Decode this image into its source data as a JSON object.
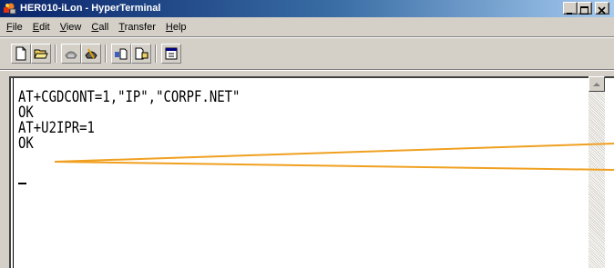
{
  "window": {
    "title": "HER010-iLon - HyperTerminal",
    "app_icon": "hyperterminal-icon",
    "controls": [
      "minimize-icon",
      "maximize-icon",
      "close-icon"
    ]
  },
  "menu": {
    "items": [
      {
        "label": "File",
        "accel": "F"
      },
      {
        "label": "Edit",
        "accel": "E"
      },
      {
        "label": "View",
        "accel": "V"
      },
      {
        "label": "Call",
        "accel": "C"
      },
      {
        "label": "Transfer",
        "accel": "T"
      },
      {
        "label": "Help",
        "accel": "H"
      }
    ]
  },
  "toolbar": {
    "buttons": [
      "new-icon",
      "open-icon",
      "call-icon",
      "disconnect-icon",
      "send-icon",
      "receive-icon",
      "properties-icon"
    ]
  },
  "terminal": {
    "lines": [
      "AT+CGDCONT=1,\"IP\",\"CORPF.NET\"",
      "OK",
      "AT+U2IPR=1",
      "OK"
    ],
    "cursor": "_"
  },
  "colors": {
    "annotation": "#f0a020",
    "titlebar_start": "#0a246a",
    "titlebar_end": "#a6caf0"
  }
}
